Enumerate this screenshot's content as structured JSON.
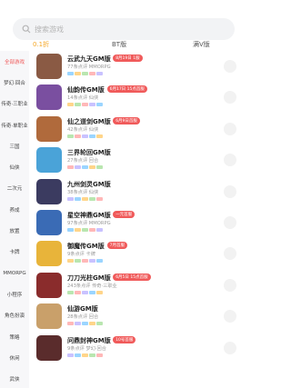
{
  "search": {
    "placeholder": "搜索游戏"
  },
  "tabs": [
    {
      "label": "0.1折",
      "active": true
    },
    {
      "label": "BT版",
      "active": false
    },
    {
      "label": "满V版",
      "active": false
    }
  ],
  "sidebar": [
    "全部游戏",
    "梦幻·回合",
    "传奇·三职业",
    "传奇·单职业",
    "三国",
    "仙侠",
    "二次元",
    "养成",
    "放置",
    "卡牌",
    "MMORPG",
    "小程序",
    "角色扮演",
    "策略",
    "休闲",
    "武侠"
  ],
  "games": [
    {
      "name": "云武九天GM版",
      "badge": "8月19日 1服",
      "badge_color": "#f05a5a",
      "meta": "77条点评 MMORPG",
      "thumb": "#8a5a44"
    },
    {
      "name": "仙韵传GM版",
      "badge": "6月17日 15点首服",
      "badge_color": "#f05a5a",
      "meta": "14条点评 仙侠",
      "thumb": "#7a4fa0"
    },
    {
      "name": "仙之道剑GM版",
      "badge": "6月9日首服",
      "badge_color": "#f05a5a",
      "meta": "42条点评 仙侠",
      "thumb": "#b06a3c"
    },
    {
      "name": "三界轮回GM版",
      "badge": "",
      "badge_color": "",
      "meta": "27条点评 回合",
      "thumb": "#4aa3d8"
    },
    {
      "name": "九州剑灵GM版",
      "badge": "",
      "badge_color": "",
      "meta": "38条点评 仙侠",
      "thumb": "#3b3b60"
    },
    {
      "name": "星空神鼎GM版",
      "badge": "一元首服",
      "badge_color": "#f05a5a",
      "meta": "97条点评 MMORPG",
      "thumb": "#3a6bb5"
    },
    {
      "name": "御魔传GM版",
      "badge": "7月首服",
      "badge_color": "#f05a5a",
      "meta": "9条点评 卡牌",
      "thumb": "#e8b43a"
    },
    {
      "name": "刀刀光柱GM版",
      "badge": "6月5日 15点首服",
      "badge_color": "#f05a5a",
      "meta": "243条点评 传奇·三职业",
      "thumb": "#8a2c2c"
    },
    {
      "name": "仙游GM版",
      "badge": "",
      "badge_color": "",
      "meta": "28条点评 回合",
      "thumb": "#c9a06a"
    },
    {
      "name": "问鼎封神GM版",
      "badge": "10号首服",
      "badge_color": "#f05a5a",
      "meta": "9条点评 梦幻·回合",
      "thumb": "#5a2c2c"
    }
  ],
  "colors": {
    "accent": "#f5a623",
    "badge_red": "#f05a5a",
    "sidebar_bg": "#f7f7f9"
  }
}
